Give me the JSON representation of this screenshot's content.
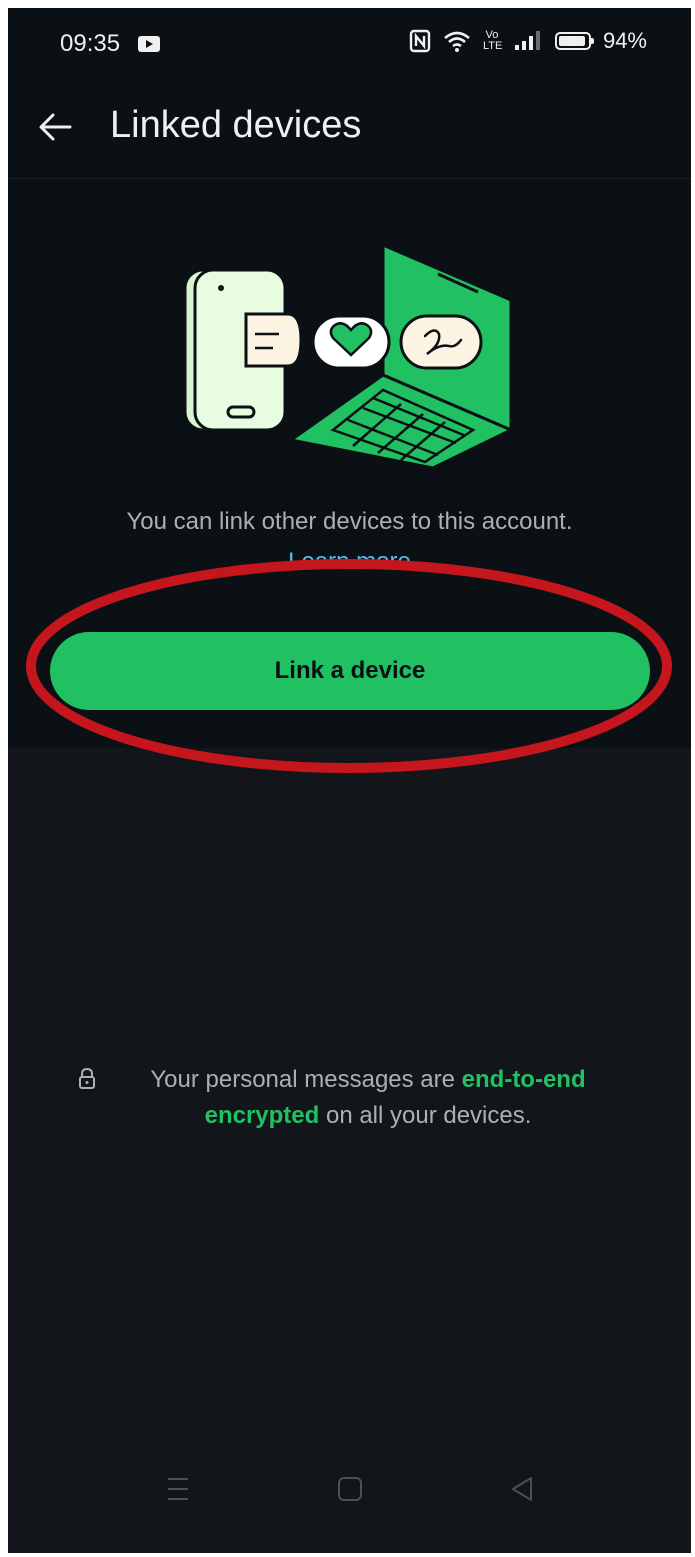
{
  "status_bar": {
    "time": "09:35",
    "nfc_icon": "nfc-icon",
    "wifi_icon": "wifi-icon",
    "volte_label": "Vo LTE",
    "signal_icon": "signal-icon",
    "battery_percent": "94%",
    "battery_level": 0.94
  },
  "header": {
    "back_icon": "arrow-left-icon",
    "title": "Linked devices"
  },
  "main": {
    "illustration": "phone-laptop-linking-illustration",
    "description": "You can link other devices to this account.",
    "learn_more_label": "Learn more",
    "link_button_label": "Link a device"
  },
  "footer": {
    "lock_icon": "lock-icon",
    "encryption_prefix": "Your personal messages are ",
    "encryption_highlight_1": "end-to-end",
    "encryption_highlight_2": "encrypted",
    "encryption_suffix": " on all your devices."
  },
  "nav_bar": {
    "menu_icon": "recents-icon",
    "home_icon": "home-icon",
    "back_icon": "back-triangle-icon"
  },
  "colors": {
    "background": "#0b1014",
    "lower_background": "#12161a",
    "accent_green": "#21c063",
    "link_blue": "#53bdeb",
    "annotation_red": "#c4161c"
  }
}
